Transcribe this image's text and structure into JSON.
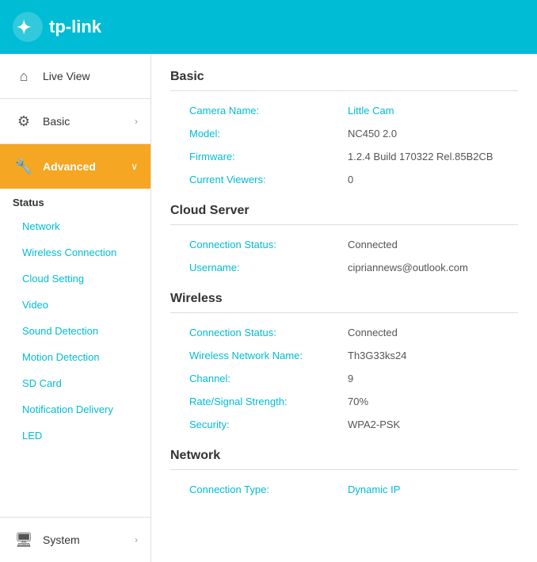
{
  "header": {
    "logo_text": "tp-link"
  },
  "sidebar": {
    "live_view_label": "Live View",
    "basic_label": "Basic",
    "advanced_label": "Advanced",
    "status_section": "Status",
    "sub_items": [
      {
        "label": "Network"
      },
      {
        "label": "Wireless Connection"
      },
      {
        "label": "Cloud Setting"
      },
      {
        "label": "Video"
      },
      {
        "label": "Sound Detection"
      },
      {
        "label": "Motion Detection"
      },
      {
        "label": "SD Card"
      },
      {
        "label": "Notification Delivery"
      },
      {
        "label": "LED"
      }
    ],
    "system_label": "System"
  },
  "content": {
    "basic_section": {
      "title": "Basic",
      "rows": [
        {
          "label": "Camera Name:",
          "value": "Little Cam",
          "is_link": true
        },
        {
          "label": "Model:",
          "value": "NC450 2.0",
          "is_link": false
        },
        {
          "label": "Firmware:",
          "value": "1.2.4 Build 170322 Rel.85B2CB",
          "is_link": false
        },
        {
          "label": "Current Viewers:",
          "value": "0",
          "is_link": false
        }
      ]
    },
    "cloud_server_section": {
      "title": "Cloud Server",
      "rows": [
        {
          "label": "Connection Status:",
          "value": "Connected",
          "is_link": false
        },
        {
          "label": "Username:",
          "value": "cipriannews@outlook.com",
          "is_link": false
        }
      ]
    },
    "wireless_section": {
      "title": "Wireless",
      "rows": [
        {
          "label": "Connection Status:",
          "value": "Connected",
          "is_link": false
        },
        {
          "label": "Wireless Network Name:",
          "value": "Th3G33ks24",
          "is_link": false
        },
        {
          "label": "Channel:",
          "value": "9",
          "is_link": false
        },
        {
          "label": "Rate/Signal Strength:",
          "value": "70%",
          "is_link": false
        },
        {
          "label": "Security:",
          "value": "WPA2-PSK",
          "is_link": false
        }
      ]
    },
    "network_section": {
      "title": "Network",
      "rows": [
        {
          "label": "Connection Type:",
          "value": "Dynamic IP",
          "is_link": true
        }
      ]
    }
  },
  "colors": {
    "teal": "#00bcd4",
    "orange": "#f5a623",
    "link_blue": "#00bcd4"
  }
}
